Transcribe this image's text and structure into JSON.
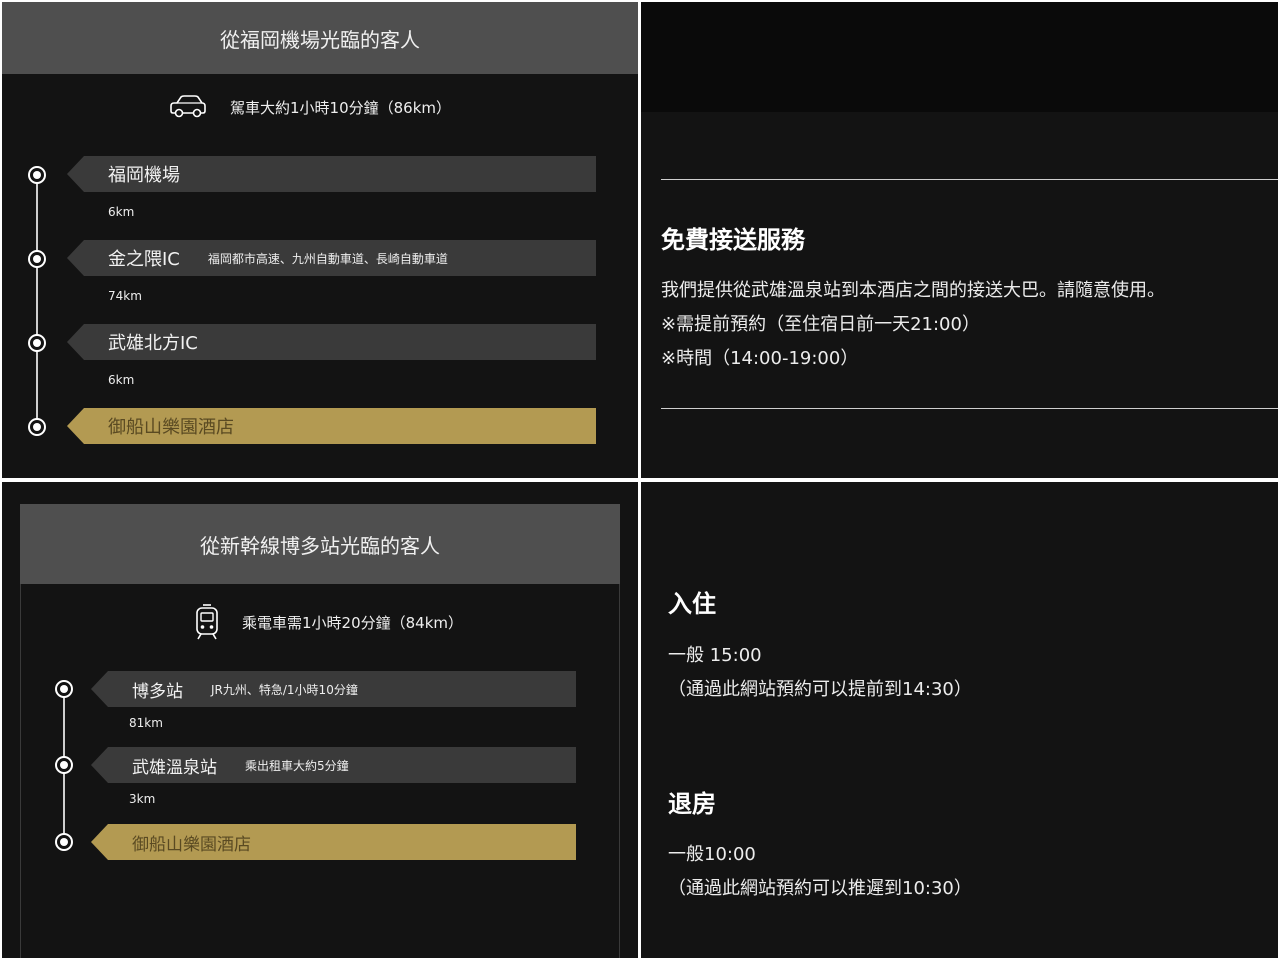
{
  "airport_route": {
    "title": "從福岡機場光臨的客人",
    "summary": "駕車大約1小時10分鐘（86km）",
    "summary_icon": "car-icon",
    "stops": [
      {
        "name": "福岡機場",
        "note": "",
        "distance": "6km"
      },
      {
        "name": "金之隈IC",
        "note": "福岡都市高速、九州自動車道、長崎自動車道",
        "distance": "74km"
      },
      {
        "name": "武雄北方IC",
        "note": "",
        "distance": "6km"
      },
      {
        "name": "御船山樂園酒店",
        "note": "",
        "distance": ""
      }
    ]
  },
  "shuttle": {
    "title": "免費接送服務",
    "lines": [
      "我們提供從武雄溫泉站到本酒店之間的接送大巴。請隨意使用。",
      "※需提前預約（至住宿日前一天21:00）",
      "※時間（14:00-19:00）"
    ]
  },
  "shinkansen_route": {
    "title": "從新幹線博多站光臨的客人",
    "summary": "乘電車需1小時20分鐘（84km）",
    "summary_icon": "train-icon",
    "stops": [
      {
        "name": "博多站",
        "note": "JR九州、特急/1小時10分鐘",
        "distance": "81km"
      },
      {
        "name": "武雄溫泉站",
        "note": "乘出租車大約5分鐘",
        "distance": "3km"
      },
      {
        "name": "御船山樂園酒店",
        "note": "",
        "distance": ""
      }
    ]
  },
  "checkin": {
    "title": "入住",
    "lines": [
      "一般 15:00",
      "（通過此網站預約可以提前到14:30）"
    ]
  },
  "checkout": {
    "title": "退房",
    "lines": [
      "一般10:00",
      "（通過此網站預約可以推遲到10:30）"
    ]
  },
  "colors": {
    "gold": "#b39a52",
    "bar": "#3a3a3a",
    "header": "#4f4f4f",
    "background": "#131313"
  }
}
